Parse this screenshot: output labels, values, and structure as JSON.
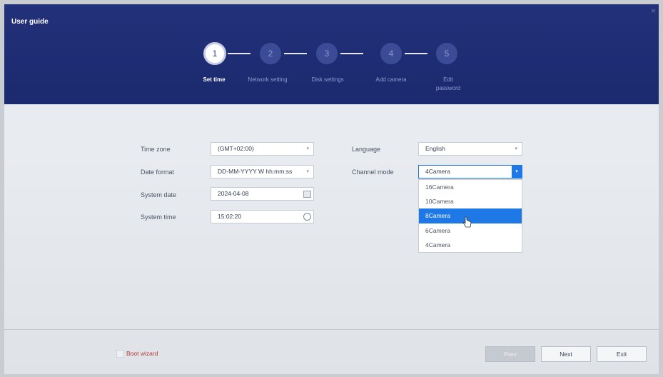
{
  "window": {
    "title": "User guide",
    "close_label": "×"
  },
  "steps": [
    {
      "num": "1",
      "label": "Set time",
      "active": true
    },
    {
      "num": "2",
      "label": "Network setting"
    },
    {
      "num": "3",
      "label": "Disk settings"
    },
    {
      "num": "4",
      "label": "Add camera"
    },
    {
      "num": "5",
      "label": "Edit password"
    }
  ],
  "form": {
    "time_zone": {
      "label": "Time zone",
      "value": "(GMT+02:00)"
    },
    "date_format": {
      "label": "Date format",
      "value": "DD-MM-YYYY W hh:mm:ss"
    },
    "system_date": {
      "label": "System date",
      "value": "2024-04-08"
    },
    "system_time": {
      "label": "System time",
      "value": "15:02:20"
    },
    "language": {
      "label": "Language",
      "value": "English"
    },
    "channel_mode": {
      "label": "Channel mode",
      "value": "4Camera",
      "options": [
        "16Camera",
        "10Camera",
        "8Camera",
        "6Camera",
        "4Camera"
      ],
      "highlighted": "8Camera"
    }
  },
  "footer": {
    "boot_wizard_label": "Boot wizard",
    "prev_label": "Prev",
    "next_label": "Next",
    "exit_label": "Exit"
  },
  "icons": {
    "dropdown_arrow": "chevron-down-icon",
    "calendar": "calendar-icon",
    "clock": "clock-icon",
    "cursor": "hand-cursor-icon"
  },
  "colors": {
    "header": "#1e2c73",
    "accent": "#1e78e6",
    "boot_wizard_text": "#b23a3a"
  }
}
